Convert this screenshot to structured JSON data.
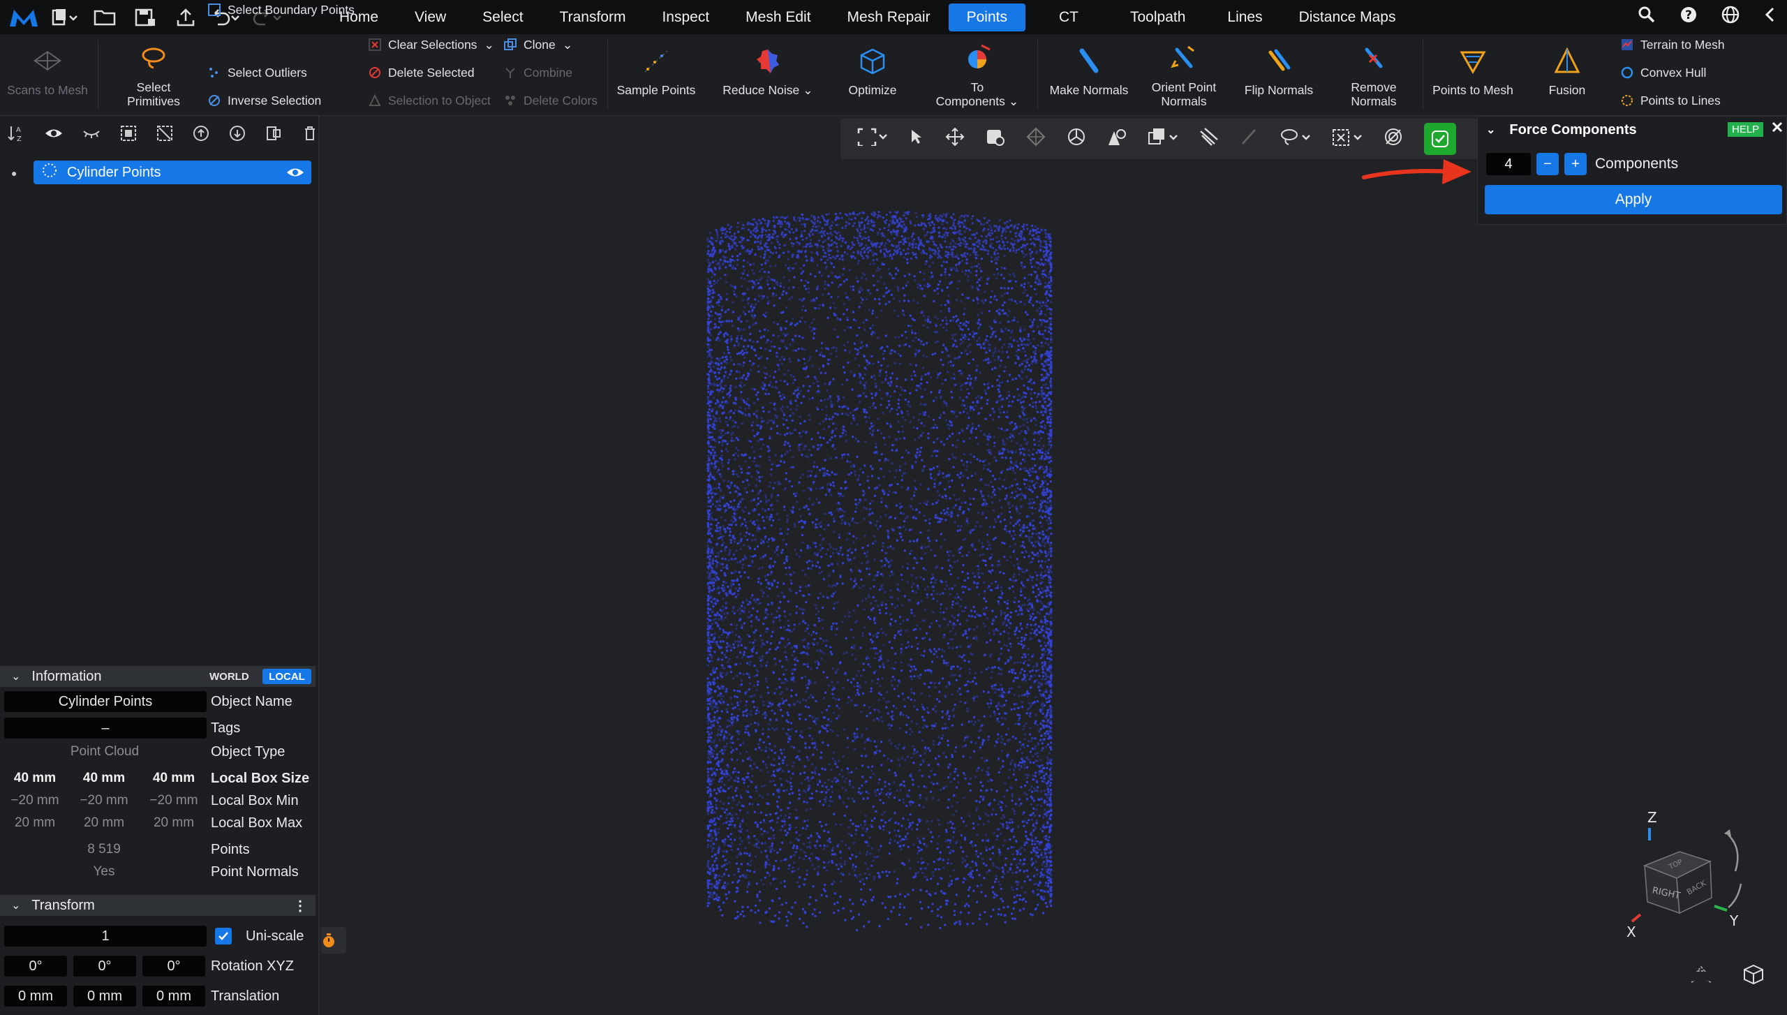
{
  "colors": {
    "accent": "#1677e6",
    "bg": "#1f2125",
    "help": "#22b14c",
    "arrow": "#e8341c",
    "points": "#3442d6"
  },
  "top_tabs": [
    "Home",
    "View",
    "Select",
    "Transform",
    "Inspect",
    "Mesh Edit",
    "Mesh Repair",
    "Points",
    "CT",
    "Toolpath",
    "Lines",
    "Distance Maps"
  ],
  "active_tab": "Points",
  "ribbon": {
    "scans_to_mesh": "Scans to Mesh",
    "select_primitives": "Select\nPrimitives",
    "select_boundary_points": "Select Boundary Points",
    "select_outliers": "Select Outliers",
    "inverse_selection": "Inverse Selection",
    "clear_selections": "Clear Selections",
    "delete_selected": "Delete Selected",
    "selection_to_object": "Selection to Object",
    "clone": "Clone",
    "combine": "Combine",
    "delete_colors": "Delete Colors",
    "sample_points": "Sample Points",
    "reduce_noise": "Reduce Noise",
    "optimize": "Optimize",
    "to_components": "To\nComponents",
    "make_normals": "Make Normals",
    "orient_point_normals": "Orient Point\nNormals",
    "flip_normals": "Flip Normals",
    "remove_normals": "Remove\nNormals",
    "points_to_mesh": "Points to Mesh",
    "fusion": "Fusion",
    "terrain_to_mesh": "Terrain to Mesh",
    "convex_hull": "Convex Hull",
    "points_to_lines": "Points to Lines"
  },
  "tree": {
    "item": "Cylinder Points"
  },
  "information": {
    "title": "Information",
    "world": "WORLD",
    "local": "LOCAL",
    "object_name_value": "Cylinder Points",
    "object_name_label": "Object Name",
    "tags_value": "–",
    "tags_label": "Tags",
    "object_type_value": "Point Cloud",
    "object_type_label": "Object Type",
    "box_size": [
      "40 mm",
      "40 mm",
      "40 mm"
    ],
    "box_size_label": "Local Box Size",
    "box_min": [
      "−20 mm",
      "−20 mm",
      "−20 mm"
    ],
    "box_min_label": "Local Box Min",
    "box_max": [
      "20 mm",
      "20 mm",
      "20 mm"
    ],
    "box_max_label": "Local Box Max",
    "points_value": "8 519",
    "points_label": "Points",
    "normals_value": "Yes",
    "normals_label": "Point Normals"
  },
  "transform": {
    "title": "Transform",
    "scale": "1",
    "uniscale_label": "Uni-scale",
    "rotation": [
      "0°",
      "0°",
      "0°"
    ],
    "rotation_label": "Rotation XYZ",
    "translation": [
      "0 mm",
      "0 mm",
      "0 mm"
    ],
    "translation_label": "Translation"
  },
  "force_components": {
    "title": "Force Components",
    "help": "HELP",
    "value": "4",
    "minus": "−",
    "plus": "+",
    "label": "Components",
    "apply": "Apply"
  },
  "gizmo": {
    "z": "Z",
    "x": "X",
    "y": "Y",
    "right": "RIGHT",
    "back": "BACK",
    "top": "TOP"
  }
}
